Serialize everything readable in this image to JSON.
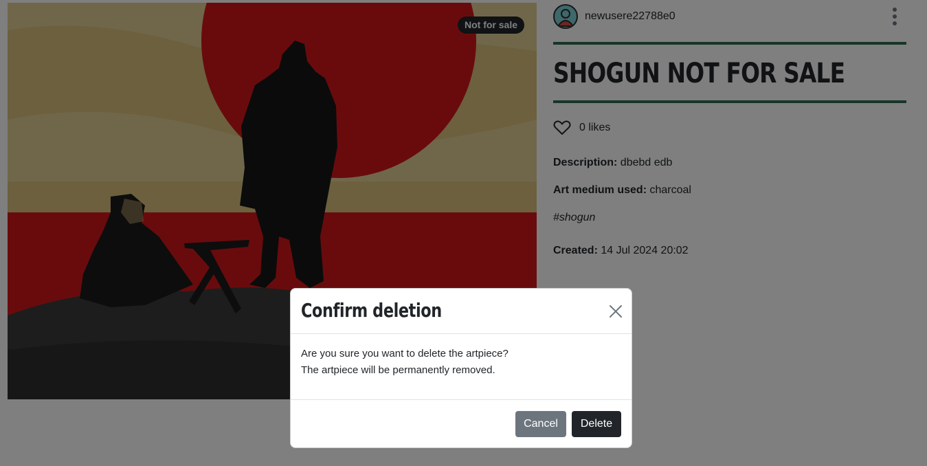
{
  "artwork": {
    "badge": "Not for sale"
  },
  "author": {
    "username": "newusere22788e0",
    "avatar_icon": "user-avatar-icon",
    "menu_icon": "kebab-menu-icon"
  },
  "artpiece": {
    "title": "SHOGUN NOT FOR SALE",
    "likes_text": "0 likes",
    "like_icon": "heart-outline-icon",
    "description_label": "Description:",
    "description_value": "dbebd edb",
    "medium_label": "Art medium used:",
    "medium_value": "charcoal",
    "hashtag": "#shogun",
    "created_label": "Created:",
    "created_value": "14 Jul 2024 20:02"
  },
  "modal": {
    "title": "Confirm deletion",
    "close_icon": "close-icon",
    "body_line1": "Are you sure you want to delete the artpiece?",
    "body_line2": "The artpiece will be permanently removed.",
    "cancel_label": "Cancel",
    "delete_label": "Delete"
  },
  "colors": {
    "accent_rule": "#2e6b4f",
    "dark_button": "#212529",
    "secondary_button": "#6c757d",
    "overlay": "rgba(0,0,0,0.5)"
  }
}
